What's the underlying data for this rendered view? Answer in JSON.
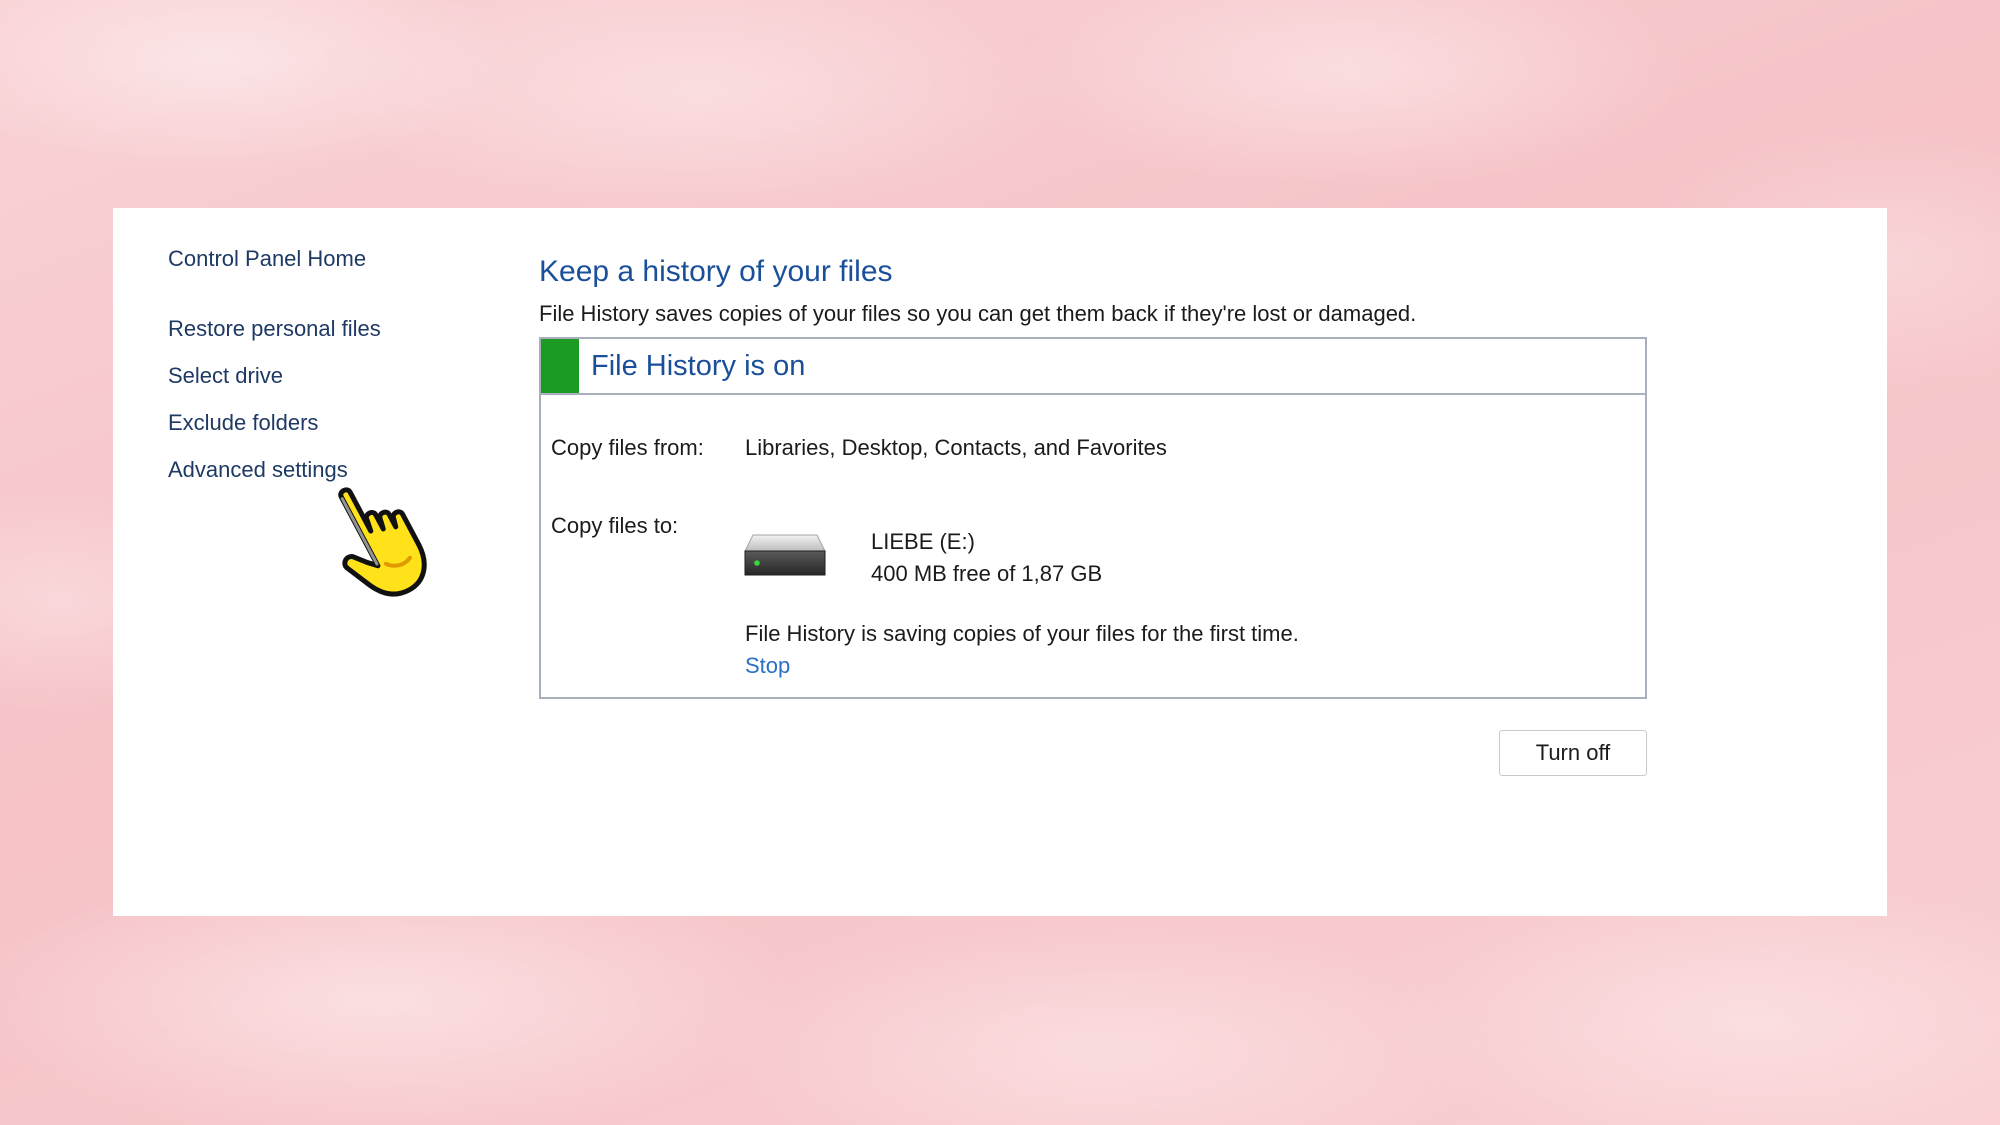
{
  "sidebar": {
    "home": "Control Panel Home",
    "items": [
      {
        "label": "Restore personal files"
      },
      {
        "label": "Select drive"
      },
      {
        "label": "Exclude folders"
      },
      {
        "label": "Advanced settings"
      }
    ]
  },
  "main": {
    "title": "Keep a history of your files",
    "subtitle": "File History saves copies of your files so you can get them back if they're lost or damaged.",
    "status": {
      "text": "File History is on",
      "color": "#1c9b22"
    },
    "copy_from": {
      "label": "Copy files from:",
      "value": "Libraries, Desktop, Contacts, and Favorites"
    },
    "copy_to": {
      "label": "Copy files to:",
      "drive_icon": "hard-drive-icon",
      "drive_name": "LIEBE (E:)",
      "drive_space": "400 MB free of 1,87 GB"
    },
    "progress_message": "File History is saving copies of your files for the first time.",
    "stop_label": "Stop",
    "turn_off_label": "Turn off"
  },
  "overlay": {
    "cursor_icon": "pointing-hand-cursor-icon"
  },
  "colors": {
    "accent_title": "#1a4f9a",
    "link": "#2a6fc4",
    "background": "#f8c9cc"
  }
}
